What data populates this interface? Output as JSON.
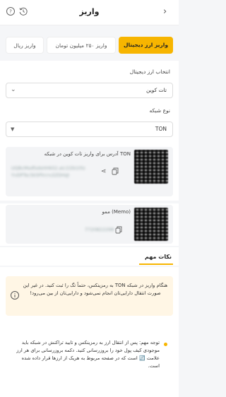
{
  "header": {
    "title": "واریز",
    "back_glyph": "›"
  },
  "tabs": [
    {
      "label": "واریز ریال",
      "active": false
    },
    {
      "label": "واریز ۲۵۰ میلیون تومان",
      "active": false
    },
    {
      "label": "واریز ارز دیجیتال",
      "active": true
    }
  ],
  "form": {
    "currency_label": "انتخاب ارز دیجیتال",
    "currency_value": "تات کوین",
    "network_label": "نوع شبکه",
    "network_value": "TON"
  },
  "address": {
    "label": "آدرس برای واریز تات کوین در شبکه TON",
    "value_line1": "UQBcMsdfsdsHHkli2.aic1l2b10lz",
    "value_line2": "YvDPTsc5k5Plrcrv2ZDHqt"
  },
  "memo": {
    "label": "ممو (Memo)",
    "value": "7720822298"
  },
  "notes": {
    "title": "نکات مهم",
    "warning": "هنگام واریز در شبکه TON به رمزینکس، حتماً تگ را ثبت کنید. در غیر این صورت انتقال دارایی‌تان انجام نمی‌شود و دارایی‌تان از بین می‌رود!",
    "info": "توجه مهم: پس از انتقال ارز به رمزینکس و تایید تراکنش در شبکه باید موجودی کیف پول خود را بروزرسانی کنید. دکمه بروزرسانی برای هر ارز علامت 🔄 است که در صفحه مربوط به هریک از ارزها قرار داده شده است."
  },
  "colors": {
    "accent": "#f7b500",
    "warning_bg": "#fff6e5",
    "warning_icon": "#555"
  }
}
